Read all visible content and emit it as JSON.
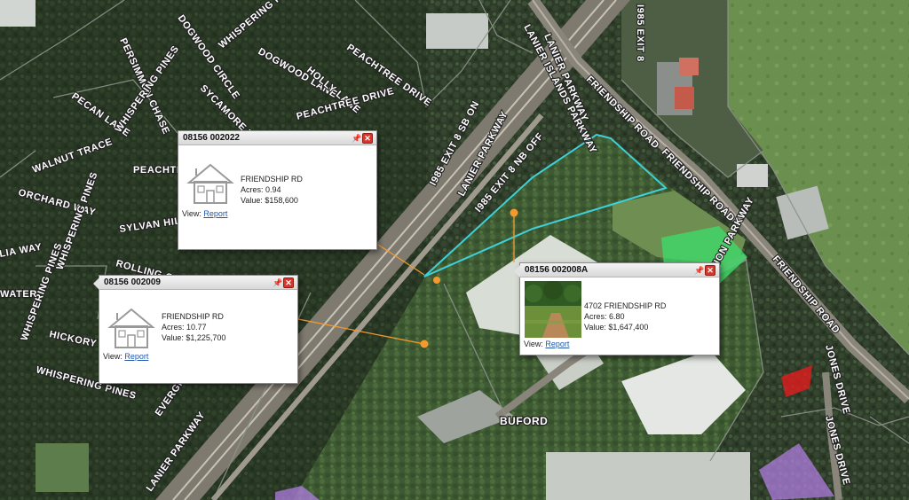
{
  "map": {
    "road_labels": [
      "LANIER ISLANDS PARKWAY",
      "LANIER PARKWAY",
      "I985 EXIT 8",
      "FRIENDSHIP ROAD",
      "FRIENDSHIP ROAD",
      "I985 EXIT 8 SB ON",
      "LANIER PARKWAY",
      "I985 EXIT 8 NB OFF",
      "FRIENDSHIP ROAD",
      "LANIER PARKWAY",
      "DISTRIBUTION PARKWAY",
      "JONES DRIVE",
      "JONES DRIVE",
      "WHISPERING PINES",
      "PERSIMMON CHASE",
      "DOGWOOD LANE",
      "PEACHTREE DRIVE",
      "HOLLY LANE",
      "PEACHTREE DRIVE",
      "PECAN LANE",
      "WHISPERING PINES",
      "WALNUT TRACE",
      "PEACHTREE DRIVE",
      "ORCHARD WAY",
      "SYLVAN HILL",
      "WHISPERING PINES",
      "ROLLING OAK",
      "WHISPERING PINES",
      "HICKORY",
      "WHISPERING PINES",
      "WATER",
      "EVERGREEN",
      "SYCAMORE TRAIL",
      "LIA WAY",
      "DOGWOOD CIRCLE"
    ],
    "place_label": "BUFORD",
    "colors": {
      "parcel_outline": "#3fd0d8",
      "connector": "#f39a2e",
      "highlight_green": "#3ddc6a",
      "highlight_red": "#d81e1e",
      "highlight_purple": "#b07ee0"
    }
  },
  "popups": [
    {
      "id": "08156 002022",
      "address": "FRIENDSHIP RD",
      "acres_label": "Acres: 0.94",
      "value_label": "Value: $158,600",
      "view_prefix": "View:",
      "link": "Report",
      "thumb": "house-icon"
    },
    {
      "id": "08156 002009",
      "address": "FRIENDSHIP RD",
      "acres_label": "Acres: 10.77",
      "value_label": "Value: $1,225,700",
      "view_prefix": "View:",
      "link": "Report",
      "thumb": "house-icon"
    },
    {
      "id": "08156 002008A",
      "address": "4702 FRIENDSHIP RD",
      "acres_label": "Acres: 6.80",
      "value_label": "Value: $1,647,400",
      "view_prefix": "View:",
      "link": "Report",
      "thumb": "parcel-photo"
    }
  ],
  "icons": {
    "pin": "pin-icon",
    "close": "close-icon"
  }
}
